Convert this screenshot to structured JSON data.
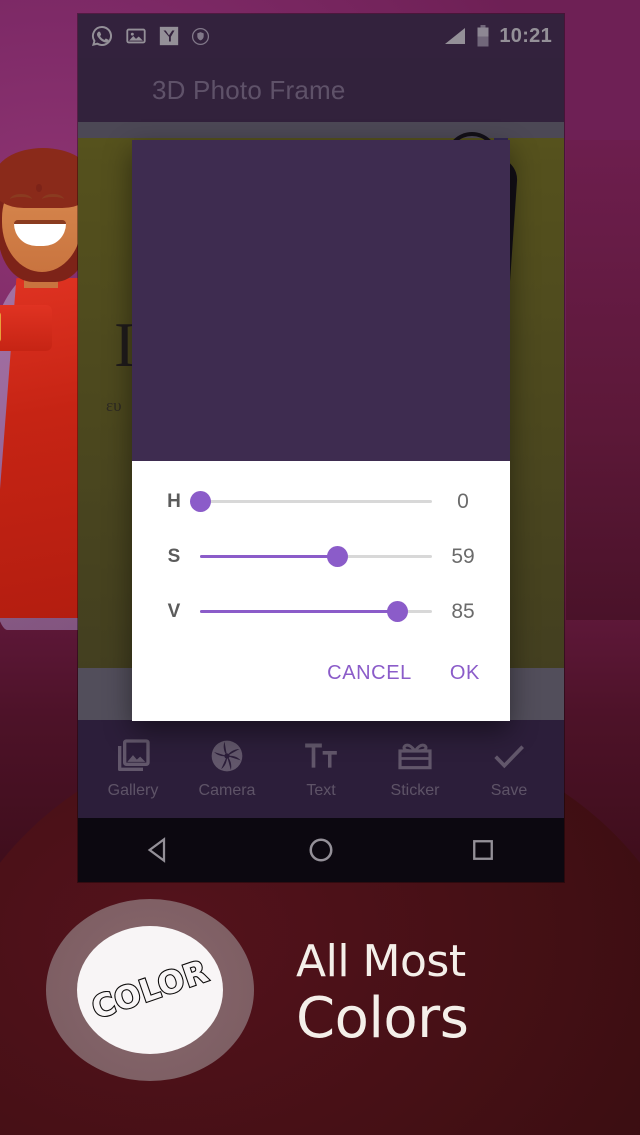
{
  "promo": {
    "badge_text": "COLOR",
    "headline_line1": "All Most",
    "headline_line2": "Colors"
  },
  "phone": {
    "statusbar": {
      "time": "10:21",
      "left_icons": [
        "whatsapp-icon",
        "photo-icon",
        "yandex-icon",
        "shield-icon"
      ],
      "right_icons": [
        "signal-icon",
        "battery-icon"
      ]
    },
    "appbar": {
      "title": "3D Photo Frame"
    },
    "canvas": {
      "photo_text_main": "I",
      "photo_text_sub": "ευ"
    },
    "toolbar": {
      "items": [
        {
          "label": "Gallery",
          "icon": "gallery-icon"
        },
        {
          "label": "Camera",
          "icon": "camera-icon"
        },
        {
          "label": "Text",
          "icon": "text-icon"
        },
        {
          "label": "Sticker",
          "icon": "sticker-icon"
        },
        {
          "label": "Save",
          "icon": "check-icon"
        }
      ]
    },
    "navbar": {
      "back": "back-icon",
      "home": "home-icon",
      "recents": "recents-icon"
    }
  },
  "dialog": {
    "preview_color": "#3e2c50",
    "accent_color": "#8b5cc9",
    "sliders": [
      {
        "label": "H",
        "value": "0",
        "percent": 0
      },
      {
        "label": "S",
        "value": "59",
        "percent": 59
      },
      {
        "label": "V",
        "value": "85",
        "percent": 85
      }
    ],
    "cancel_label": "CANCEL",
    "ok_label": "OK"
  }
}
